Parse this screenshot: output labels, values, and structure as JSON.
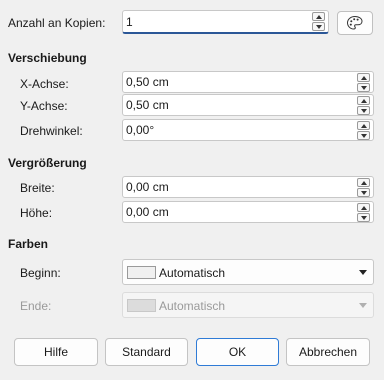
{
  "copies": {
    "label": "Anzahl an Kopien:",
    "value": "1"
  },
  "placement": {
    "heading": "Verschiebung",
    "x_label": "X-Achse:",
    "x_value": "0,50 cm",
    "y_label": "Y-Achse:",
    "y_value": "0,50 cm",
    "angle_label": "Drehwinkel:",
    "angle_value": "0,00°"
  },
  "enlargement": {
    "heading": "Vergrößerung",
    "width_label": "Breite:",
    "width_value": "0,00 cm",
    "height_label": "Höhe:",
    "height_value": "0,00 cm"
  },
  "colors": {
    "heading": "Farben",
    "start_label": "Beginn:",
    "start_value": "Automatisch",
    "end_label": "Ende:",
    "end_value": "Automatisch"
  },
  "buttons": {
    "help": "Hilfe",
    "standard": "Standard",
    "ok": "OK",
    "cancel": "Abbrechen"
  },
  "icons": {
    "palette_button": "palette-icon"
  }
}
